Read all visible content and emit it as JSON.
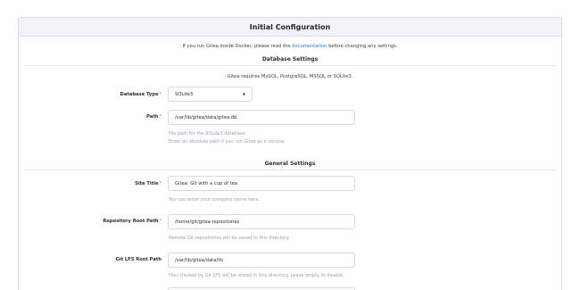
{
  "header": {
    "title": "Initial Configuration"
  },
  "notice": {
    "before": "If you run Gitea inside Docker, please read the",
    "link": "documentation",
    "after": "before changing any settings."
  },
  "database": {
    "section_title": "Database Settings",
    "note": "Gitea requires MySQL, PostgreSQL, MSSQL or SQLite3.",
    "type_label": "Database Type",
    "type_value": "SQLite3",
    "path_label": "Path",
    "path_value": "/var/lib/gitea/data/gitea.db",
    "path_help_1": "File path for the SQLite3 database.",
    "path_help_2": "Enter an absolute path if you run Gitea as a service."
  },
  "general": {
    "section_title": "General Settings",
    "site_title_label": "Site Title",
    "site_title_value": "Gitea: Git with a cup of tea",
    "site_title_help": "You can enter your company name here.",
    "repo_root_label": "Repository Root Path",
    "repo_root_value": "/home/git/gitea-repositories",
    "repo_root_help": "Remote Git repositories will be saved to this directory.",
    "lfs_label": "Git LFS Root Path",
    "lfs_value": "/var/lib/gitea/data/lfs",
    "lfs_help": "Files tracked by Git LFS will be stored in this directory. Leave empty to disable."
  },
  "required_mark": "*"
}
